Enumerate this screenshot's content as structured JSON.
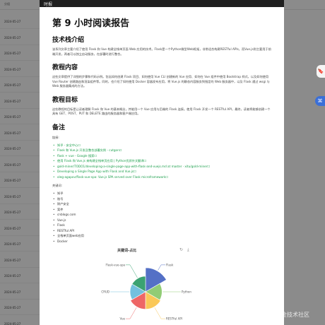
{
  "background": {
    "header_label": "分组",
    "dates": [
      "2024-05-27",
      "2024-05-27",
      "2024-05-27",
      "2024-05-27",
      "2024-05-27",
      "2024-05-27",
      "2024-05-27",
      "2024-05-27",
      "2024-05-27",
      "2024-05-27",
      "2024-05-27",
      "2024-05-27",
      "2024-05-27",
      "2024-05-27",
      "2024-05-27",
      "2024-05-27",
      "2024-05-27",
      "2024-05-27",
      "2024-05-27",
      "2024-05-27"
    ]
  },
  "modal": {
    "header_title": "时报",
    "report_title": "第 9 小时阅读报告",
    "sections": {
      "tech_intro": {
        "heading": "技术栈介绍",
        "text": "该系列文章主要介绍了使用 Flask 和 Vue 构建全栈单页面 Web 应用的技术。Flask是一个Python微型Web框架，非常适合构建RESTful APIs，而Vue.js则主要用于前端开发，两者可以独立启动服务，在部署时进行整合。"
      },
      "content": {
        "heading": "教程内容",
        "text": "这些文章提供了详细的步骤和代码示例。包括如何创建 Flask 项目、如何使用 Vue CLI 创建新的 Vue 应用、如何在 Vue 组件中使用 Bootstrap 样式，以及如何使用 Vue Router 创建路由和渲染组件等。同时，也介绍了如何使用 Docker 容器发布应用，将 Vue.js 的静态内容服务到指定的 Web 服务器中，以及 Flask 通过 wsgi 与 Web 服务器集成的方法。"
      },
      "goals": {
        "heading": "教程目标",
        "text": "这些教程的目标是让读者理解 Flask 和 Vue 的基本概念，并能用一个 Vue 应用与后端的 Flask 连接。使用 Flask 开发一个 RESTful API，最终，读者将能够创建一个具有 GET、POST、PUT 和 DELETE 路由的服务器和客户端应用。"
      },
      "notes": {
        "heading": "备注",
        "links_label": "链接:",
        "links": [
          "知乎 - 安全中心☐",
          "Flask 和 Vue.js 开发及整合部署实例 - cutgon☐",
          "flask + vue - Google 搜索☐",
          "使用 Flask 和 Vue.js 来构建全栈单页应用 | Python优质外文翻译☐",
          "gold-miner/TODO1/developing-a-single-page-app-with-flask-and-vuejs.md at master · xitu/gold-miner☐",
          "Developing a Single Page App with Flask and Vue.js☐",
          "oleg-agapov/flask-vue-spa: Vue.js SPA served over Flask microframework☐"
        ],
        "keywords_label": "关键词:",
        "keywords": [
          "知乎",
          "账号",
          "财产安全",
          "案件",
          "cnblogs.com",
          "Vue.js",
          "Flask",
          "RESTful API",
          "全栈单页面web应用",
          "Docker"
        ]
      }
    },
    "chart_tools": {
      "refresh_icon": "↻",
      "download_icon": "⤓"
    }
  },
  "chart_data": {
    "type": "pie",
    "variant": "nightingale-rose",
    "title": "关键词-占比",
    "categories": [
      "Flask",
      "Python",
      "RESTful API",
      "Vue",
      "CRUD",
      "Flask-vue-spa"
    ],
    "values": [
      30,
      14,
      16,
      16,
      12,
      12
    ],
    "colors": [
      "#5470c6",
      "#91cc75",
      "#fac858",
      "#ee6666",
      "#73c0de",
      "#3ba272"
    ]
  },
  "side_icons": {
    "top": "🔖",
    "middle": "⌘"
  },
  "watermark": "@稀土掘金技术社区"
}
